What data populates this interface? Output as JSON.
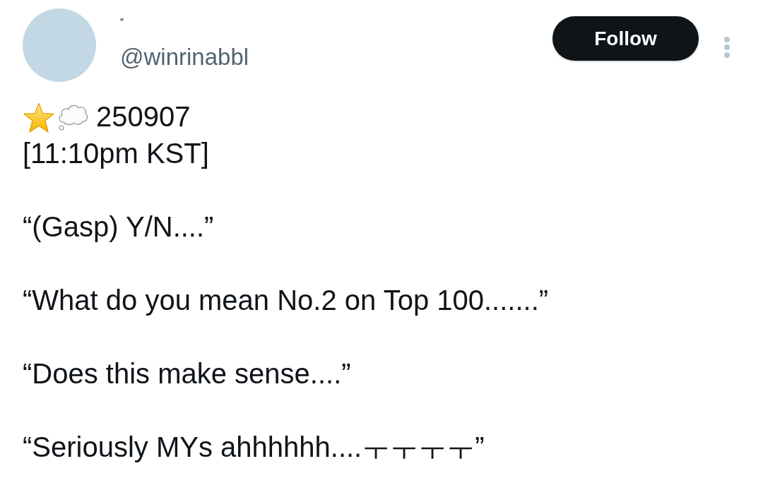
{
  "author": {
    "display_name": "″",
    "handle": "@winrinabbl"
  },
  "follow_button": {
    "label": "Follow"
  },
  "post": {
    "date": "250907",
    "time": "[11:10pm KST]",
    "quotes": [
      "“(Gasp) Y/N....”",
      "“What do you mean No.2 on Top 100.......”",
      "“Does this make sense....”",
      "“Seriously MYs ahhhhhh....ㅜㅜㅜㅜ”"
    ]
  }
}
